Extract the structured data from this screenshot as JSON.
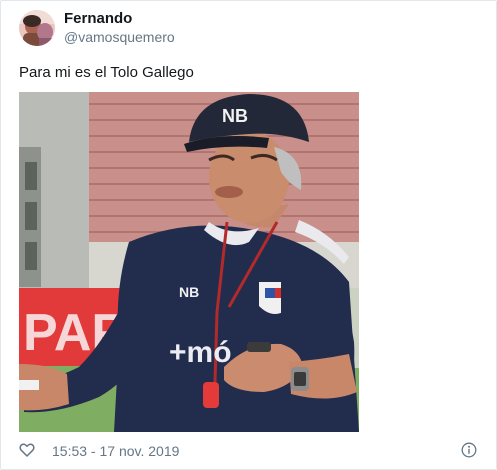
{
  "user": {
    "display_name": "Fernando",
    "handle": "@vamosquemero"
  },
  "tweet": {
    "text": "Para mi es el Tolo Gallego",
    "timestamp": "15:53 - 17 nov. 2019"
  },
  "media": {
    "background_banner_text": "PAF",
    "cap_logo_text": "NB",
    "shirt_brand_text": "+mó",
    "shirt_logo_text": "NB"
  },
  "icons": {
    "like": "heart-icon",
    "info": "info-icon"
  },
  "colors": {
    "name_text": "#14171a",
    "secondary_text": "#657786",
    "border": "#e1e8ed"
  }
}
